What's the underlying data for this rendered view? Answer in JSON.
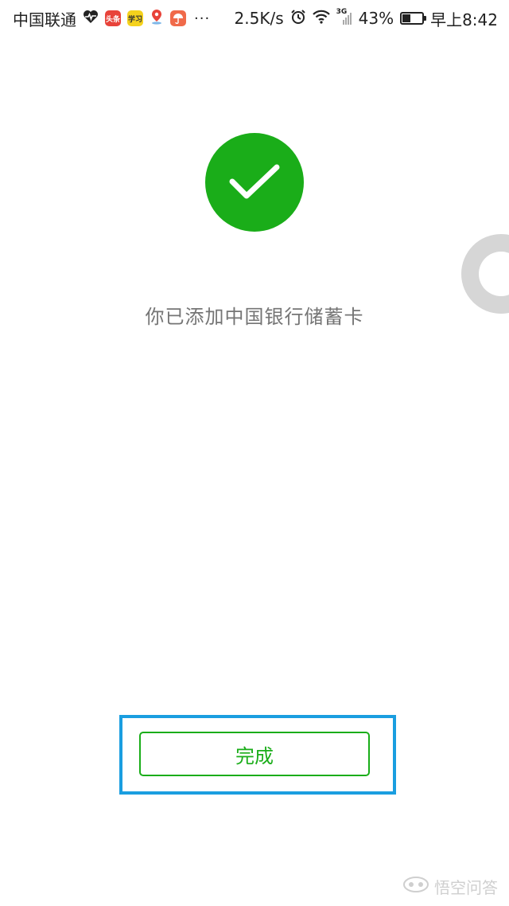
{
  "status_bar": {
    "carrier": "中国联通",
    "app_icons": [
      {
        "name": "heart-rate-icon",
        "color": "#222222"
      },
      {
        "name": "toutiao-icon",
        "label": "头条",
        "color": "#e8433a"
      },
      {
        "name": "xuexi-icon",
        "label": "学习",
        "color": "#f5d21c"
      },
      {
        "name": "map-pin-icon",
        "color": "#e8433a"
      },
      {
        "name": "umbrella-app-icon",
        "color": "#f06a4a"
      }
    ],
    "more": "···",
    "net_speed": "2.5K/s",
    "network": "3G",
    "battery_percent": "43%",
    "battery_level": 0.43,
    "time": "早上8:42"
  },
  "main": {
    "message": "你已添加中国银行储蓄卡",
    "done_label": "完成"
  },
  "colors": {
    "success_green": "#1aad19",
    "highlight_blue": "#1a9ee0"
  },
  "watermark": {
    "text": "悟空问答"
  }
}
